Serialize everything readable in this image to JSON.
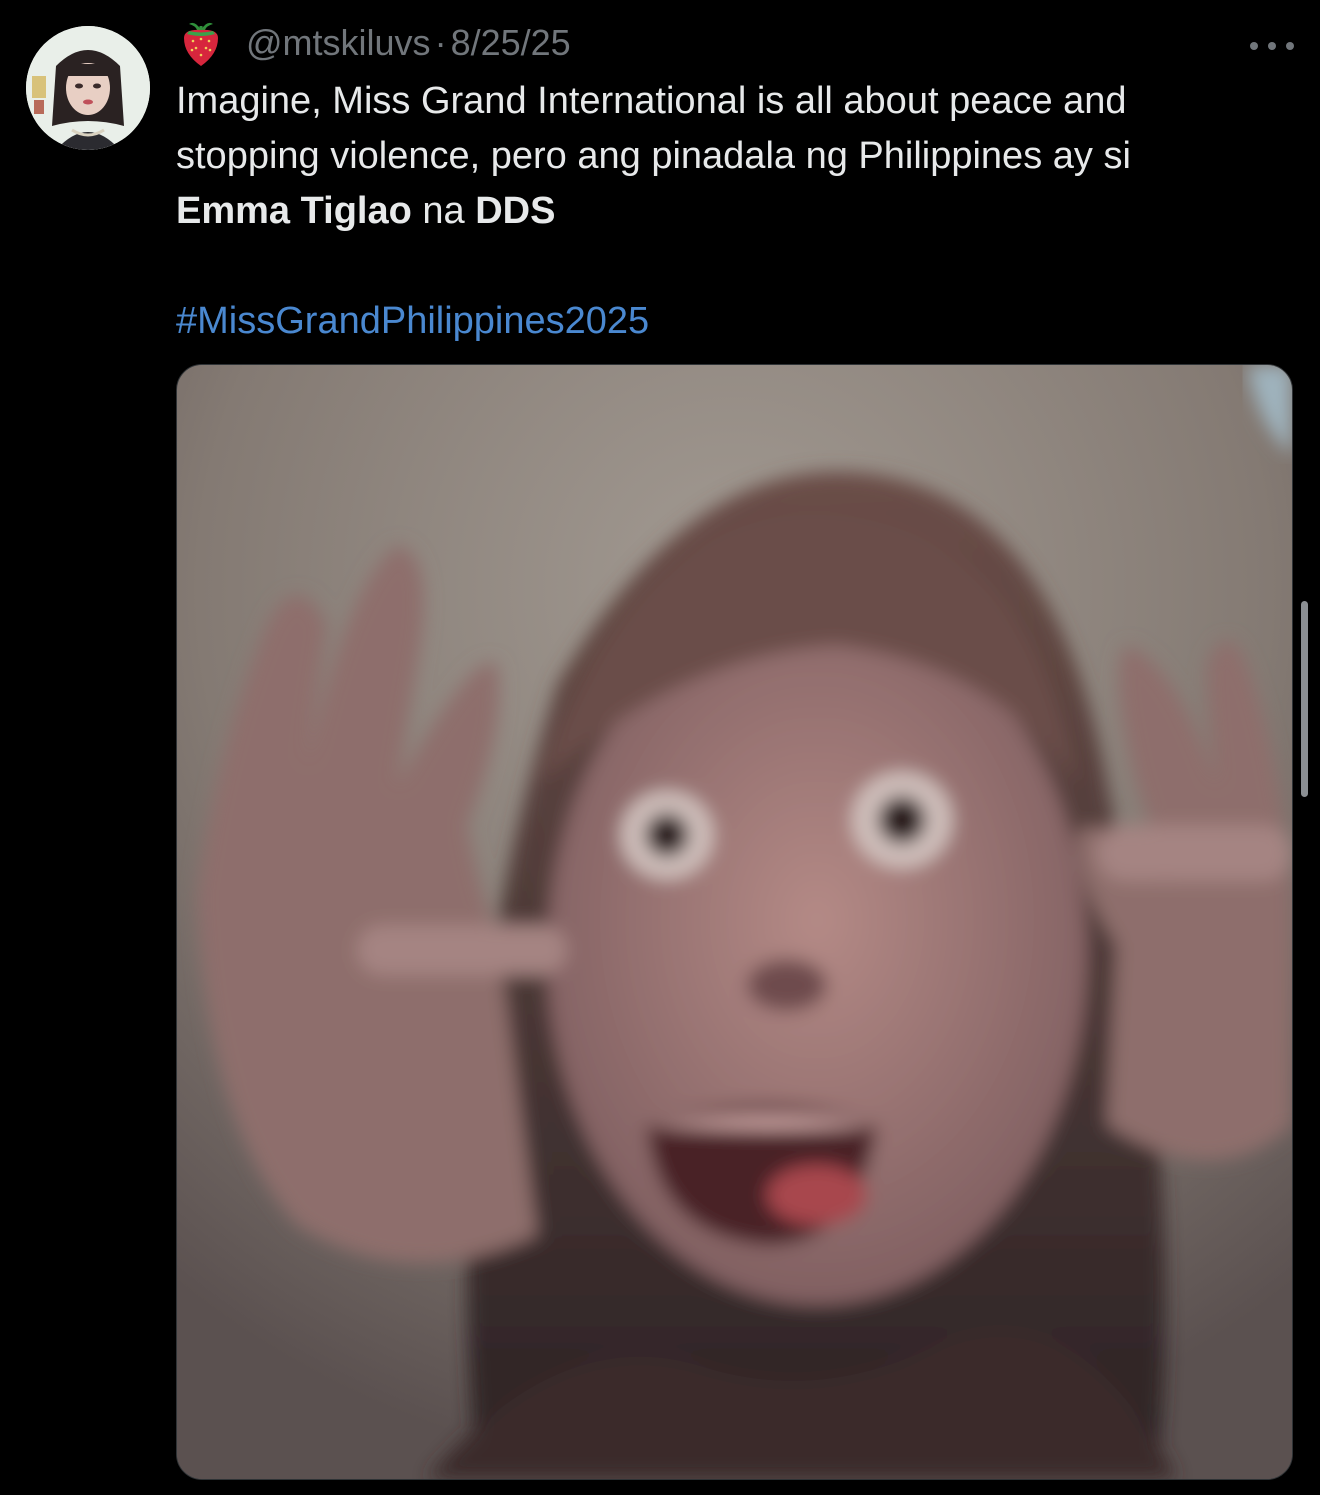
{
  "tweet": {
    "author_handle": "@mtskiluvs",
    "separator": "·",
    "date": "8/25/25",
    "badge_icon": "strawberry-icon",
    "more_icon": "ellipsis-icon",
    "line1": "Imagine, Miss Grand International is all about peace and",
    "line2": "stopping violence, pero ang pinadala ng Philippines ay si",
    "line3_bold1": "Emma Tiglao",
    "line3_mid": " na ",
    "line3_bold2": "DDS",
    "hashtag": "#MissGrandPhilippines2025"
  },
  "colors": {
    "background": "#000000",
    "text": "#e7e9ea",
    "secondary_text": "#71767b",
    "link": "#4a88d0"
  }
}
